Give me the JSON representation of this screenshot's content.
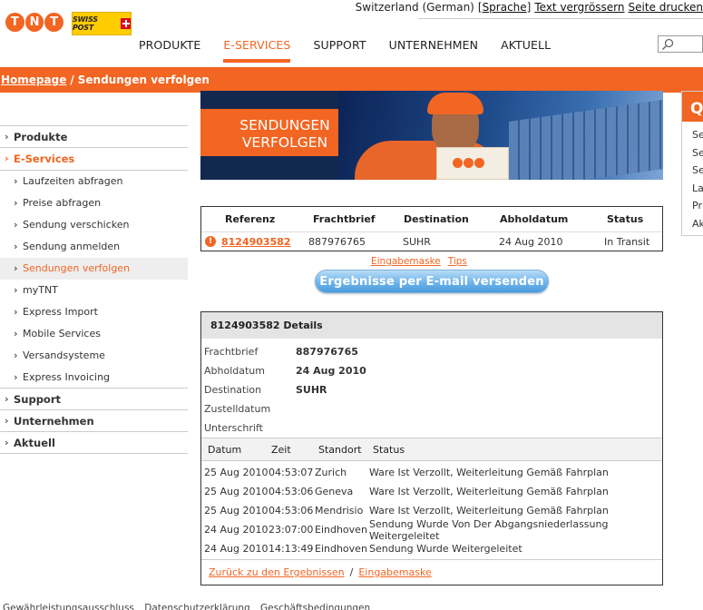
{
  "top": {
    "region": "Switzerland (German)",
    "language_link": "Sprache",
    "text_size_link": "Text vergrössern",
    "print_link": "Seite drucken"
  },
  "brand": {
    "tnt_letters": [
      "T",
      "N",
      "T"
    ],
    "swisspost": "SWISS POST"
  },
  "nav": {
    "items": [
      {
        "label": "PRODUKTE",
        "active": false
      },
      {
        "label": "E-SERVICES",
        "active": true
      },
      {
        "label": "SUPPORT",
        "active": false
      },
      {
        "label": "UNTERNEHMEN",
        "active": false
      },
      {
        "label": "AKTUELL",
        "active": false
      }
    ]
  },
  "breadcrumb": {
    "home": "Homepage",
    "current": "Sendungen verfolgen"
  },
  "sidebar": {
    "produkte": "Produkte",
    "eservices": "E-Services",
    "sub": [
      "Laufzeiten abfragen",
      "Preise abfragen",
      "Sendung verschicken",
      "Sendung anmelden",
      "Sendungen verfolgen",
      "myTNT",
      "Express Import",
      "Mobile Services",
      "Versandsysteme",
      "Express Invoicing"
    ],
    "support": "Support",
    "unternehmen": "Unternehmen",
    "aktuell": "Aktuell"
  },
  "banner": {
    "title_line1": "SENDUNGEN",
    "title_line2": "VERFOLGEN"
  },
  "quick": {
    "head": "Q",
    "items": [
      "Se",
      "Se",
      "Se",
      "La",
      "Pr",
      "Ak"
    ]
  },
  "results": {
    "headers": {
      "ref": "Referenz",
      "fb": "Frachtbrief",
      "dest": "Destination",
      "date": "Abholdatum",
      "status": "Status"
    },
    "row": {
      "ref": "8124903582",
      "fb": "887976765",
      "dest": "SUHR",
      "date": "24 Aug 2010",
      "status": "In Transit"
    },
    "link_mask": "Eingabemaske",
    "link_tips": "Tips",
    "email_button": "Ergebnisse per E-mail versenden"
  },
  "details": {
    "title": "8124903582 Details",
    "fields": [
      {
        "label": "Frachtbrief",
        "value": "887976765"
      },
      {
        "label": "Abholdatum",
        "value": "24 Aug 2010"
      },
      {
        "label": "Destination",
        "value": "SUHR"
      },
      {
        "label": "Zustelldatum",
        "value": ""
      },
      {
        "label": "Unterschrift",
        "value": ""
      }
    ],
    "track_headers": {
      "date": "Datum",
      "time": "Zeit",
      "loc": "Standort",
      "status": "Status"
    },
    "track": [
      {
        "date": "25 Aug 2010",
        "time": "04:53:07",
        "loc": "Zurich",
        "status": "Ware Ist Verzollt, Weiterleitung Gemäß Fahrplan"
      },
      {
        "date": "25 Aug 2010",
        "time": "04:53:06",
        "loc": "Geneva",
        "status": "Ware Ist Verzollt, Weiterleitung Gemäß Fahrplan"
      },
      {
        "date": "25 Aug 2010",
        "time": "04:53:06",
        "loc": "Mendrisio",
        "status": "Ware Ist Verzollt, Weiterleitung Gemäß Fahrplan"
      },
      {
        "date": "24 Aug 2010",
        "time": "23:07:00",
        "loc": "Eindhoven",
        "status": "Sendung Wurde Von Der Abgangsniederlassung Weitergeleitet"
      },
      {
        "date": "24 Aug 2010",
        "time": "14:13:49",
        "loc": "Eindhoven",
        "status": "Sendung Wurde Weitergeleitet"
      }
    ],
    "back_link": "Zurück zu den Ergebnissen",
    "mask_link": "Eingabemaske"
  },
  "footer": {
    "links": [
      "Gewährleistungsausschluss",
      "Datenschutzerklärung",
      "Geschäftsbedingungen"
    ]
  }
}
